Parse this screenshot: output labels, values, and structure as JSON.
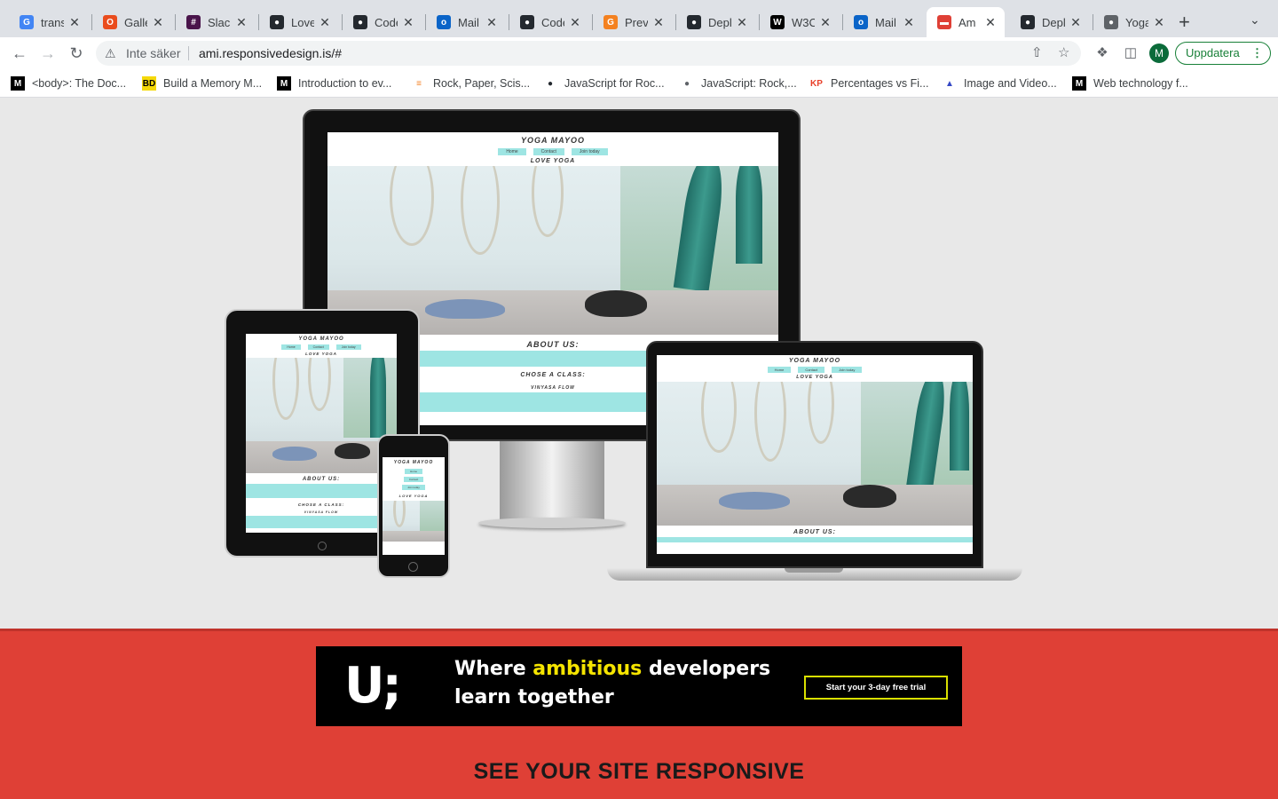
{
  "browser": {
    "tabs": [
      {
        "label": "trans",
        "icon": "google-icon",
        "color": "#4285f4"
      },
      {
        "label": "Galle",
        "icon": "circle-icon",
        "color": "#ea4c1d"
      },
      {
        "label": "Slack",
        "icon": "slack-icon",
        "color": "#4a154b"
      },
      {
        "label": "Love",
        "icon": "github-icon",
        "color": "#24292f"
      },
      {
        "label": "Code",
        "icon": "github-icon",
        "color": "#24292f"
      },
      {
        "label": "Mail -",
        "icon": "outlook-icon",
        "color": "#0a64c8"
      },
      {
        "label": "Code",
        "icon": "github-icon",
        "color": "#24292f"
      },
      {
        "label": "Previ",
        "icon": "preview-icon",
        "color": "#f48120"
      },
      {
        "label": "Depl",
        "icon": "github-icon",
        "color": "#24292f"
      },
      {
        "label": "W3C",
        "icon": "w3c-icon",
        "color": "#000000"
      },
      {
        "label": "Mail -",
        "icon": "outlook-icon",
        "color": "#0a64c8"
      },
      {
        "label": "Am I",
        "icon": "amiresponsive-icon",
        "color": "#df4036"
      },
      {
        "label": "Depl",
        "icon": "github-icon",
        "color": "#24292f"
      },
      {
        "label": "Yoga",
        "icon": "globe-icon",
        "color": "#5f6368"
      }
    ],
    "active_tab": 11,
    "security_label": "Inte säker",
    "url": "ami.responsivedesign.is/#",
    "profile_initial": "M",
    "update_label": "Uppdatera",
    "bookmarks": [
      {
        "label": "<body>: The Doc...",
        "icon": "mdn-icon"
      },
      {
        "label": "Build a Memory M...",
        "icon": "bd-icon"
      },
      {
        "label": "Introduction to ev...",
        "icon": "mdn-icon"
      },
      {
        "label": "Rock, Paper, Scis...",
        "icon": "stackoverflow-icon"
      },
      {
        "label": "JavaScript for Roc...",
        "icon": "github-icon"
      },
      {
        "label": "JavaScript: Rock,...",
        "icon": "globe-icon"
      },
      {
        "label": "Percentages vs Fi...",
        "icon": "kp-icon"
      },
      {
        "label": "Image and Video...",
        "icon": "imagekit-icon"
      },
      {
        "label": "Web technology f...",
        "icon": "mdn-icon"
      }
    ]
  },
  "mockup": {
    "site_title": "YOGA MAYOO",
    "nav": [
      "Home",
      "Contact",
      "Join today"
    ],
    "subtitle": "LOVE YOGA",
    "about": "ABOUT US:",
    "choose": "CHOSE A CLASS:",
    "class_name": "VINYASA FLOW"
  },
  "ad": {
    "logo": "U;",
    "line1_a": "Where ",
    "line1_highlight": "ambitious",
    "line1_b": " developers",
    "line2": "learn together",
    "cta": "Start your 3-day free trial"
  },
  "page": {
    "heading": "SEE YOUR SITE RESPONSIVE"
  }
}
